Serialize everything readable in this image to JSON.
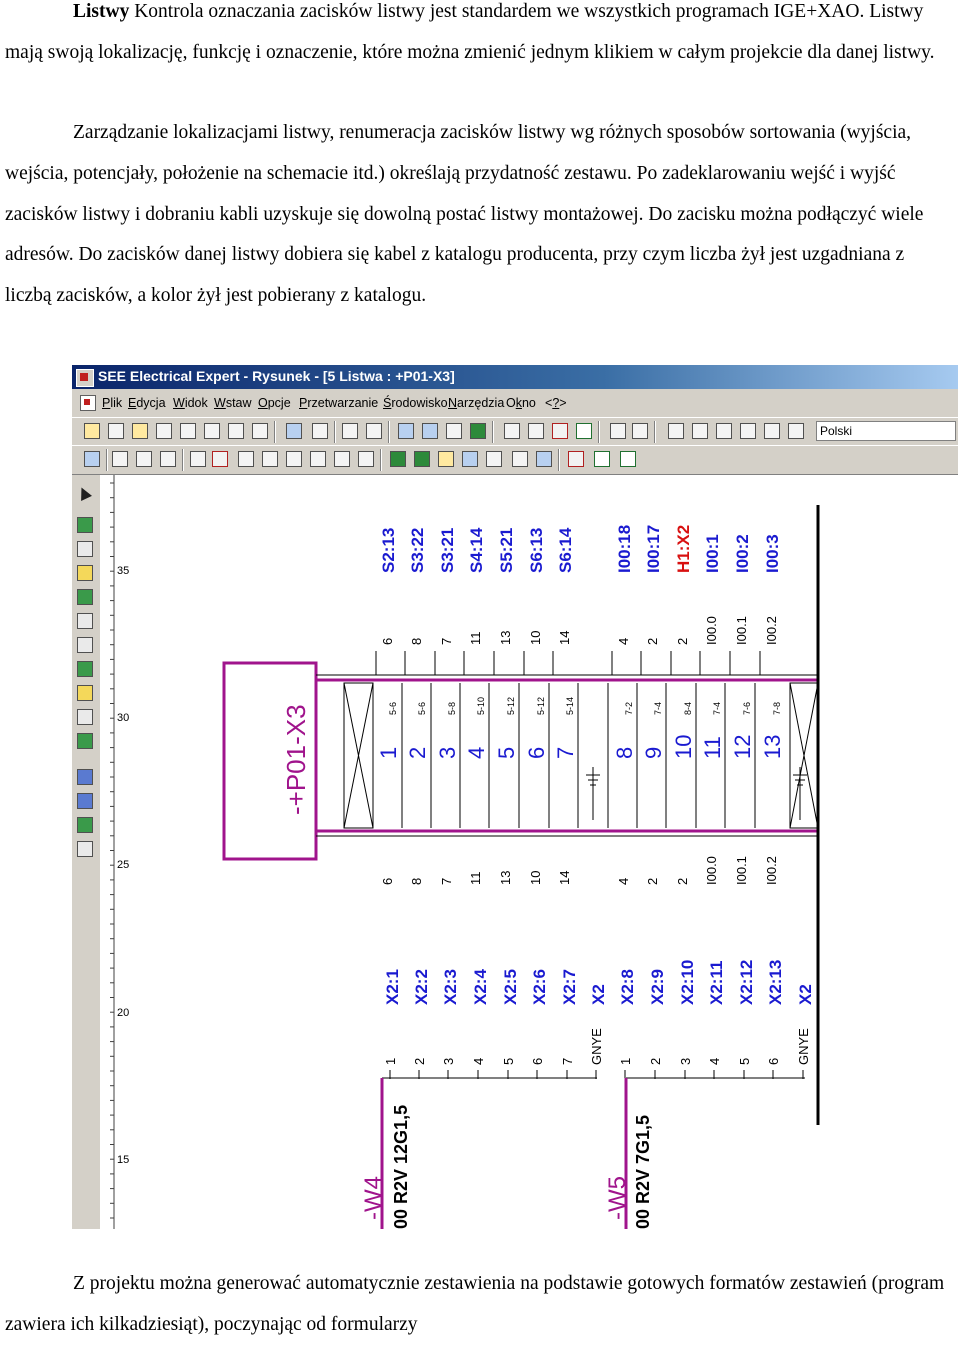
{
  "paragraph1": {
    "bold": "Listwy",
    "text": " Kontrola oznaczania zacisków listwy jest standardem we wszystkich programach IGE+XAO. Listwy mają swoją lokalizację, funkcję i oznaczenie, które można zmienić jednym klikiem w całym projekcie dla danej listwy."
  },
  "paragraph2": {
    "text": "Zarządzanie lokalizacjami listwy, renumeracja zacisków listwy wg różnych sposobów sortowania (wyjścia, wejścia, potencjały, położenie na schemacie itd.) określają przydatność zestawu. Po zadeklarowaniu wejść i wyjść zacisków listwy i dobraniu kabli uzyskuje się dowolną postać listwy montażowej. Do zacisku można podłączyć wiele adresów. Do zacisków danej listwy dobiera się kabel z katalogu producenta, przy czym liczba żył jest uzgadniana z liczbą zacisków, a kolor żył jest pobierany z katalogu."
  },
  "paragraph3": {
    "text": "Z projektu można generować automatycznie zestawienia na podstawie gotowych formatów zestawień (program zawiera ich kilkadziesiąt), poczynając od formularzy"
  },
  "app": {
    "title": "SEE Electrical Expert - Rysunek - [5 Listwa : +P01-X3]",
    "menu": [
      "Plik",
      "Edycja",
      "Widok",
      "Wstaw",
      "Opcje",
      "Przetwarzanie",
      "Środowisko",
      "Narzędzia",
      "Okno",
      "<?>"
    ],
    "menu_underline": [
      "P",
      "E",
      "W",
      "W",
      "O",
      "P",
      "Ś",
      "N",
      "k",
      "?"
    ],
    "language": "Polski"
  },
  "drawing": {
    "ruler_labels": [
      "35",
      "30",
      "25",
      "20",
      "15"
    ],
    "strip_name": "-+P01-X3",
    "top_addresses": [
      "S2:13",
      "S3:22",
      "S3:21",
      "S4:14",
      "S5:21",
      "S6:13",
      "S6:14",
      "I00:18",
      "I00:17",
      "H1:X2",
      "I00:1",
      "I00:2",
      "I00:3"
    ],
    "top_potentials": [
      "6",
      "8",
      "7",
      "11",
      "13",
      "10",
      "14",
      "4",
      "2",
      "2",
      "I00.0",
      "I00.1",
      "I00.2"
    ],
    "terminal_numbers": [
      "1",
      "2",
      "3",
      "4",
      "5",
      "6",
      "7",
      "8",
      "9",
      "10",
      "11",
      "12",
      "13"
    ],
    "terminal_refs": [
      "5-6",
      "5-6",
      "5-8",
      "5-10",
      "5-12",
      "5-12",
      "5-14",
      "7-2",
      "7-4",
      "8-4",
      "7-4",
      "7-6",
      "7-8"
    ],
    "bottom_potentials": [
      "6",
      "8",
      "7",
      "11",
      "13",
      "10",
      "14",
      "4",
      "2",
      "2",
      "I00.0",
      "I00.1",
      "I00.2"
    ],
    "bottom_addresses": [
      "X2:1",
      "X2:2",
      "X2:3",
      "X2:4",
      "X2:5",
      "X2:6",
      "X2:7",
      "X2",
      "X2:8",
      "X2:9",
      "X2:10",
      "X2:11",
      "X2:12",
      "X2:13",
      "X2"
    ],
    "cores": [
      "1",
      "2",
      "3",
      "4",
      "5",
      "6",
      "7",
      "GNYE",
      "1",
      "2",
      "3",
      "4",
      "5",
      "6",
      "GNYE"
    ],
    "cable1_name": "-W4",
    "cable1_type": "00 R2V 12G1,5",
    "cable2_name": "-W5",
    "cable2_type": "00 R2V 7G1,5"
  },
  "colors": {
    "magenta": "#a0148c",
    "label_blue": "#1a1ad0",
    "label_red": "#d81010"
  }
}
